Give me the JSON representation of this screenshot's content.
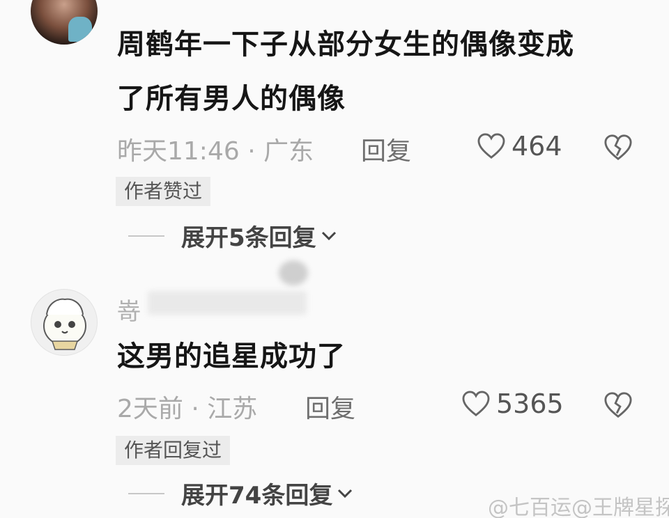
{
  "comments": [
    {
      "text_line1": "周鹤年一下子从部分女生的偶像变成",
      "text_line2": "了所有男人的偶像",
      "meta": "昨天11:46 · 广东",
      "reply_label": "回复",
      "likes": "464",
      "badge": "作者赞过",
      "expand_label": "展开5条回复"
    },
    {
      "username_partial": "嵜",
      "text": "这男的追星成功了",
      "meta": "2天前 · 江苏",
      "reply_label": "回复",
      "likes": "5365",
      "badge": "作者回复过",
      "expand_label": "展开74条回复"
    }
  ],
  "watermark": "@七百运@王牌星探",
  "icons": {
    "like": "heart-outline-icon",
    "dislike": "broken-heart-icon",
    "expand": "chevron-down-icon"
  },
  "colors": {
    "text": "#161616",
    "meta": "#a9a9a9",
    "badge_bg": "#ececec"
  }
}
